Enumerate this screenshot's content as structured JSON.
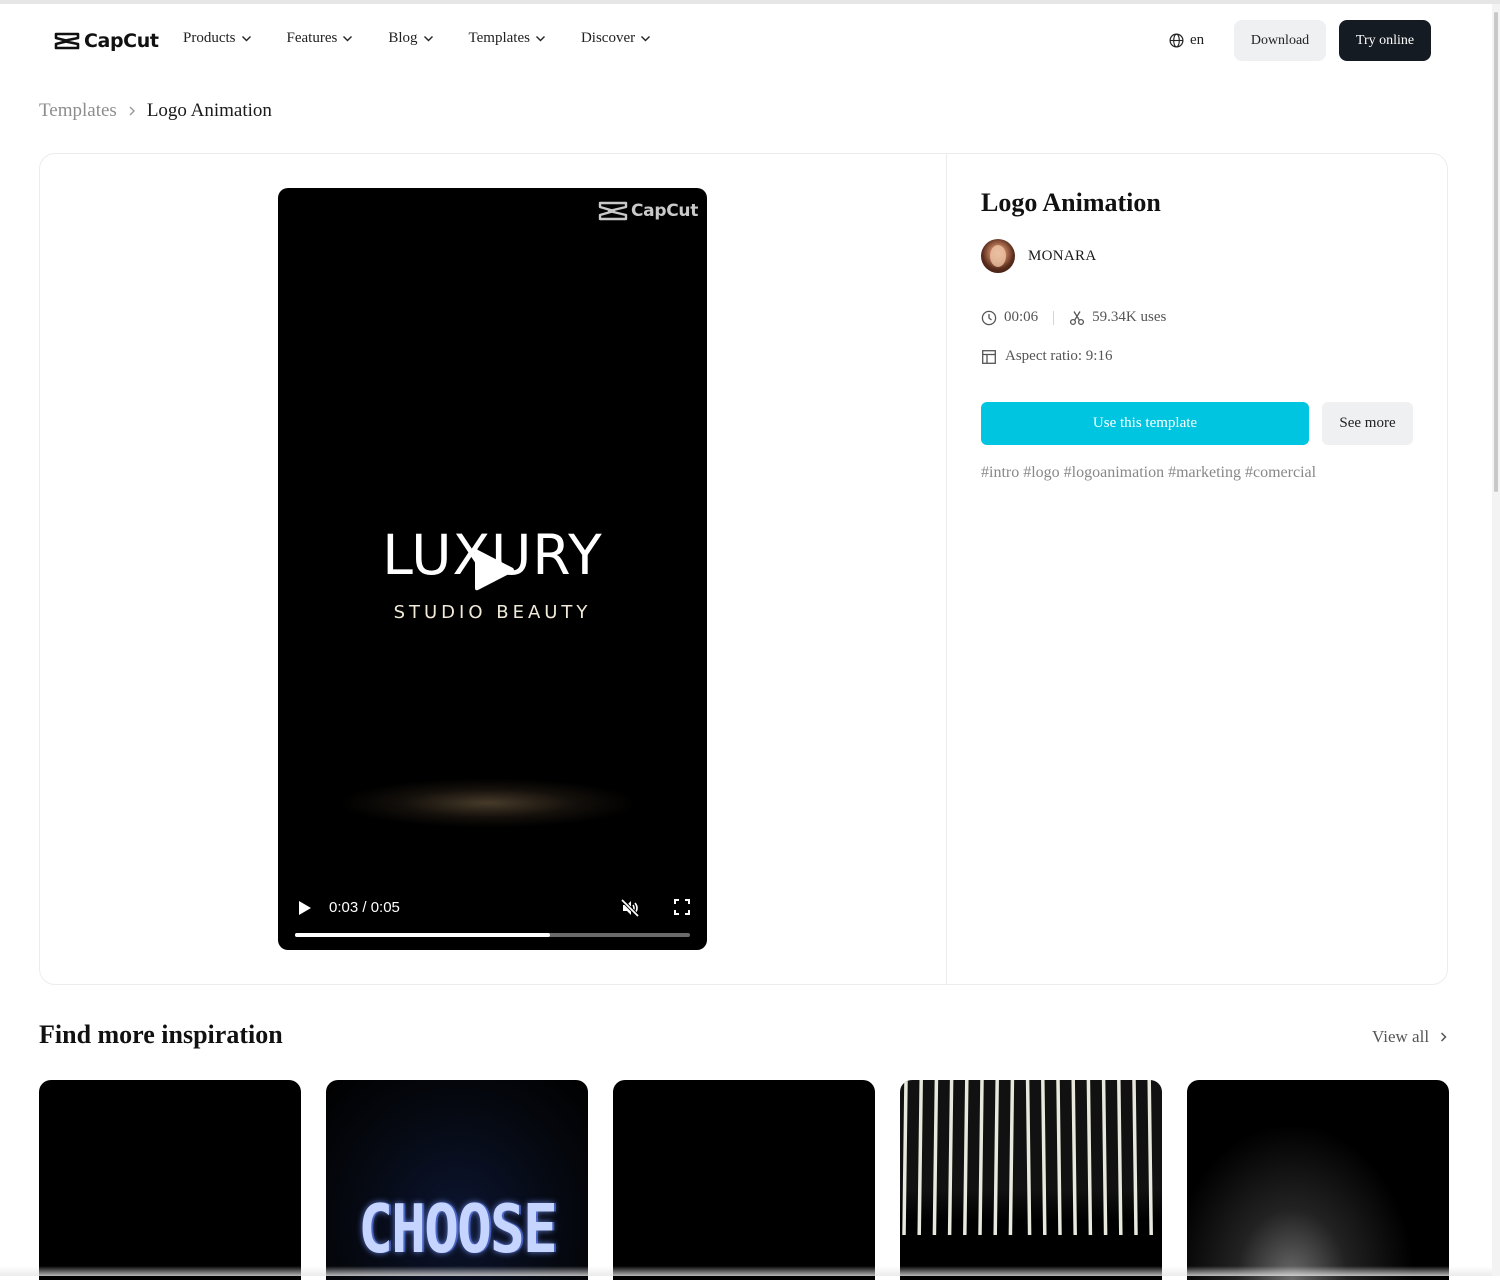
{
  "nav": {
    "brand": "CapCut",
    "menu": [
      {
        "label": "Products"
      },
      {
        "label": "Features"
      },
      {
        "label": "Blog"
      },
      {
        "label": "Templates"
      },
      {
        "label": "Discover"
      }
    ],
    "language": "en",
    "download_label": "Download",
    "try_online_label": "Try online"
  },
  "breadcrumb": {
    "parent": "Templates",
    "current": "Logo Animation"
  },
  "video": {
    "watermark": "CapCut",
    "headline": "LUXURY",
    "subline": "STUDIO BEAUTY",
    "time_display": "0:03 / 0:05",
    "progress_fraction": 0.645
  },
  "template": {
    "title": "Logo Animation",
    "author": "MONARA",
    "duration": "00:06",
    "uses": "59.34K uses",
    "aspect_ratio": "Aspect ratio: 9:16",
    "use_label": "Use this template",
    "see_more_label": "See more",
    "tags": [
      "#intro",
      "#logo",
      "#logoanimation",
      "#marketing",
      "#comercial"
    ]
  },
  "inspiration": {
    "title": "Find more inspiration",
    "view_all": "View all",
    "thumbnails": [
      {
        "text": ""
      },
      {
        "text": "CHOOSE"
      },
      {
        "text": ""
      },
      {
        "text": ""
      },
      {
        "text": ""
      }
    ]
  },
  "colors": {
    "accent": "#00c5e0",
    "dark_button": "#151b22",
    "light_button": "#eef0f1"
  }
}
